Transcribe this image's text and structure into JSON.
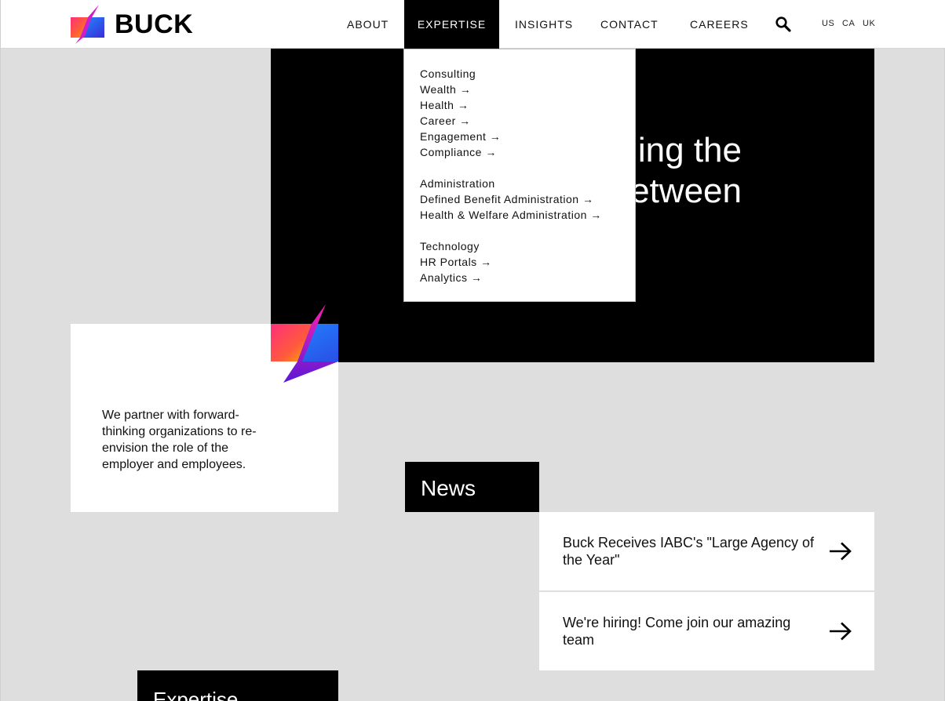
{
  "brand": {
    "name": "BUCK"
  },
  "nav": {
    "items": [
      {
        "label": "ABOUT"
      },
      {
        "label": "EXPERTISE"
      },
      {
        "label": "INSIGHTS"
      },
      {
        "label": "CONTACT"
      },
      {
        "label": "CAREERS"
      }
    ],
    "active": "EXPERTISE",
    "search_icon": "search-icon",
    "locales": [
      "US",
      "CA",
      "UK"
    ]
  },
  "dropdown": {
    "groups": [
      {
        "heading": "Consulting",
        "items": [
          "Wealth →",
          "Health →",
          "Career →",
          "Engagement →",
          "Compliance →"
        ]
      },
      {
        "heading": "Administration",
        "items": [
          "Defined Benefit Administration →",
          "Health & Welfare Administration →"
        ]
      },
      {
        "heading": "Technology",
        "items": [
          "HR Portals →",
          "Analytics →"
        ]
      }
    ]
  },
  "hero": {
    "line1": "ing the",
    "line2": "etween"
  },
  "intro": {
    "text": "We partner with forward-thinking organizations to re-envision the role of the employer and employees."
  },
  "news": {
    "heading": "News",
    "items": [
      {
        "title": "Buck Receives IABC's \"Large Agency of the Year\"",
        "icon": "arrow-right-icon"
      },
      {
        "title": "We're hiring! Come join our amazing team",
        "icon": "arrow-right-icon"
      }
    ]
  },
  "expertise": {
    "heading": "Expertise"
  },
  "colors": {
    "accent_magenta": "#ff1f8e",
    "accent_blue": "#1e6bff",
    "accent_purple": "#5a18d6",
    "dark": "#000000",
    "background": "#dedede"
  }
}
